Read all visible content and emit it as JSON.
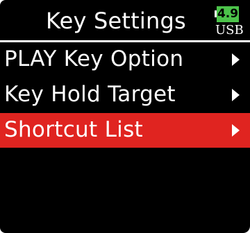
{
  "header": {
    "title": "Key Settings",
    "battery": {
      "level": "4.9",
      "source": "USB",
      "color": "#4cc34a",
      "icon": "battery-icon"
    }
  },
  "menu": {
    "items": [
      {
        "label": "PLAY Key Option",
        "icon": "chevron-right-icon",
        "selected": false
      },
      {
        "label": "Key Hold Target",
        "icon": "chevron-right-icon",
        "selected": false
      },
      {
        "label": "Shortcut List",
        "icon": "chevron-right-icon",
        "selected": true
      }
    ],
    "selected_color": "#e02420"
  }
}
